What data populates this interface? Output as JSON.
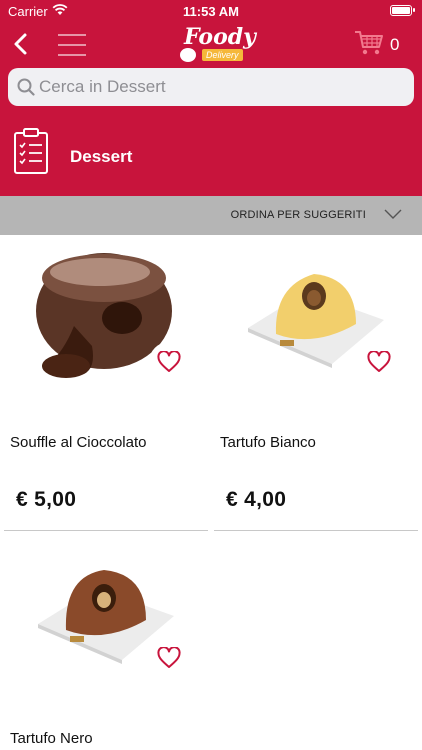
{
  "status_bar": {
    "carrier": "Carrier",
    "time": "11:53 AM"
  },
  "nav": {
    "logo_text": "Foody",
    "logo_sub": "Delivery",
    "cart_count": "0"
  },
  "search": {
    "placeholder": "Cerca in Dessert",
    "value": ""
  },
  "category": {
    "title": "Dessert"
  },
  "sort": {
    "label": "ORDINA PER SUGGERITI"
  },
  "products": [
    {
      "name": "Souffle al Cioccolato",
      "price": "€ 5,00"
    },
    {
      "name": "Tartufo Bianco",
      "price": "€ 4,00"
    },
    {
      "name": "Tartufo Nero",
      "price": ""
    }
  ],
  "colors": {
    "brand": "#c8143c",
    "sort_bar": "#b5b5b5",
    "accent_logo": "#f5b83a"
  },
  "icons": [
    "back-icon",
    "menu-icon",
    "cart-icon",
    "search-icon",
    "clipboard-icon",
    "chevron-down-icon",
    "heart-icon"
  ]
}
